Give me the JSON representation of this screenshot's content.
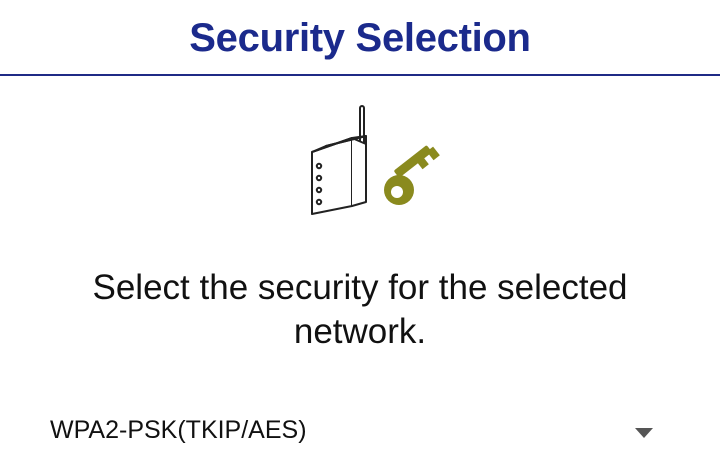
{
  "header": {
    "title": "Security Selection"
  },
  "illustration": {
    "icons": [
      "router-icon",
      "key-icon"
    ],
    "key_color": "#8a8a1e"
  },
  "message": {
    "line1": "Select the security for the selected",
    "line2": "network."
  },
  "security_select": {
    "selected_value": "WPA2-PSK(TKIP/AES)",
    "icon": "chevron-down-icon"
  },
  "colors": {
    "title": "#1b2a8c",
    "divider": "#1f2a86",
    "text": "#111111"
  }
}
